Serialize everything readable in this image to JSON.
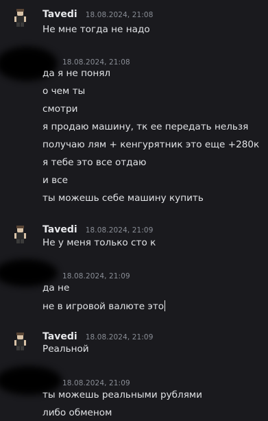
{
  "messages": [
    {
      "author": "Tavedi",
      "timestamp": "18.08.2024, 21:08",
      "lines": [
        "Не мне тогда не надо"
      ]
    },
    {
      "author": "",
      "timestamp": "18.08.2024, 21:08",
      "lines": [
        "да я не понял",
        "о чем ты",
        "смотри",
        "я продаю машину, тк ее передать нельзя",
        "получаю лям + кенгурятник это еще +280к",
        "я тебе это все отдаю",
        "и все",
        "ты можешь себе машину купить"
      ]
    },
    {
      "author": "Tavedi",
      "timestamp": "18.08.2024, 21:09",
      "lines": [
        "Не у меня только сто к"
      ]
    },
    {
      "author": "",
      "timestamp": "18.08.2024, 21:09",
      "lines": [
        "да не",
        "не в игровой валюте это"
      ]
    },
    {
      "author": "Tavedi",
      "timestamp": "18.08.2024, 21:09",
      "lines": [
        "Реальной"
      ]
    },
    {
      "author": "",
      "timestamp": "18.08.2024, 21:09",
      "lines": [
        "ты можешь реальными рублями",
        "либо обменом"
      ]
    }
  ]
}
